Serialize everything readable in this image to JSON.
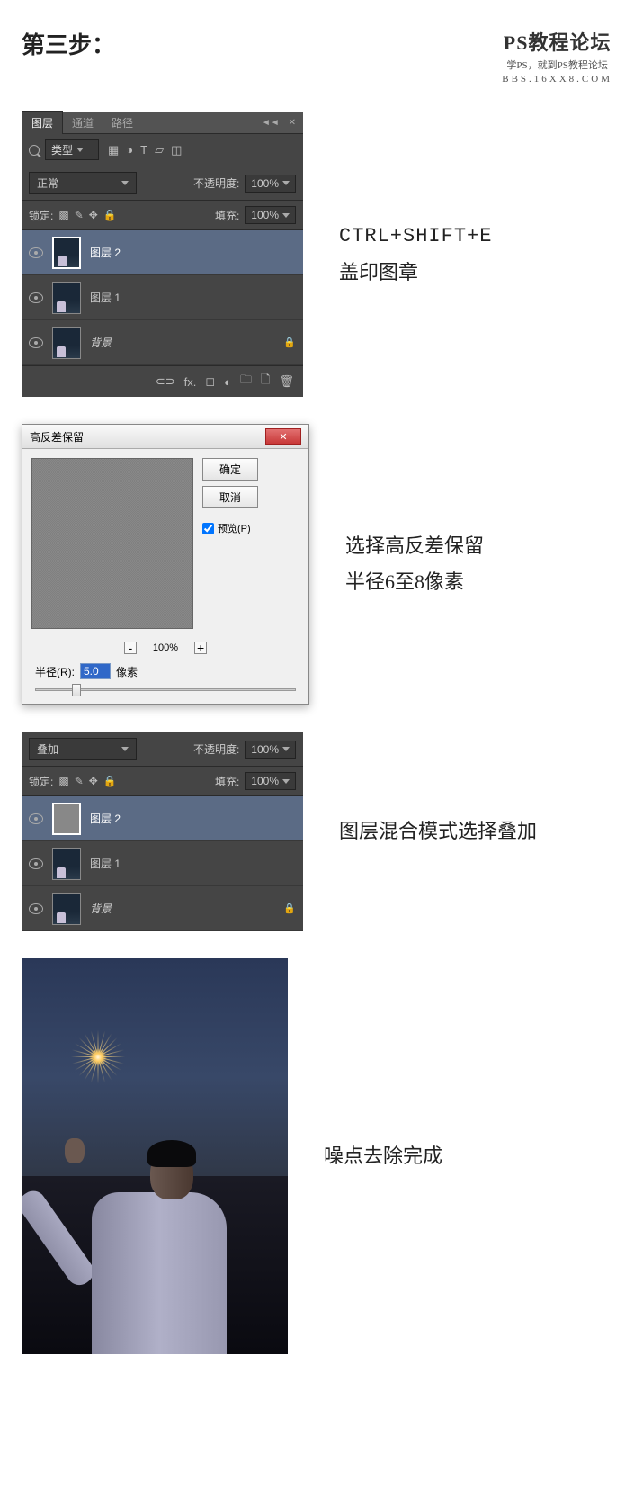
{
  "header": {
    "step_title": "第三步：",
    "brand_title": "PS教程论坛",
    "brand_sub": "学PS，就到PS教程论坛",
    "brand_url": "BBS.16XX8.COM"
  },
  "panel1": {
    "tabs": {
      "layers": "图层",
      "channels": "通道",
      "paths": "路径"
    },
    "filter_label": "类型",
    "blend_mode": "正常",
    "opacity_label": "不透明度:",
    "opacity_value": "100%",
    "lock_label": "锁定:",
    "fill_label": "填充:",
    "fill_value": "100%",
    "layers": [
      {
        "name": "图层 2",
        "selected": true
      },
      {
        "name": "图层 1",
        "selected": false
      },
      {
        "name": "背景",
        "selected": false,
        "locked": true
      }
    ]
  },
  "caption1": {
    "shortcut": "CTRL+SHIFT+E",
    "text": "盖印图章"
  },
  "dialog": {
    "title": "高反差保留",
    "ok": "确定",
    "cancel": "取消",
    "preview": "预览(P)",
    "zoom": "100%",
    "radius_label": "半径(R):",
    "radius_value": "5.0",
    "radius_unit": "像素"
  },
  "caption2": {
    "line1": "选择高反差保留",
    "line2": "半径6至8像素"
  },
  "panel3": {
    "blend_mode": "叠加",
    "opacity_label": "不透明度:",
    "opacity_value": "100%",
    "lock_label": "锁定:",
    "fill_label": "填充:",
    "fill_value": "100%",
    "layers": [
      {
        "name": "图层 2",
        "selected": true
      },
      {
        "name": "图层 1",
        "selected": false
      },
      {
        "name": "背景",
        "selected": false,
        "locked": true
      }
    ]
  },
  "caption3": "图层混合模式选择叠加",
  "caption4": "噪点去除完成"
}
